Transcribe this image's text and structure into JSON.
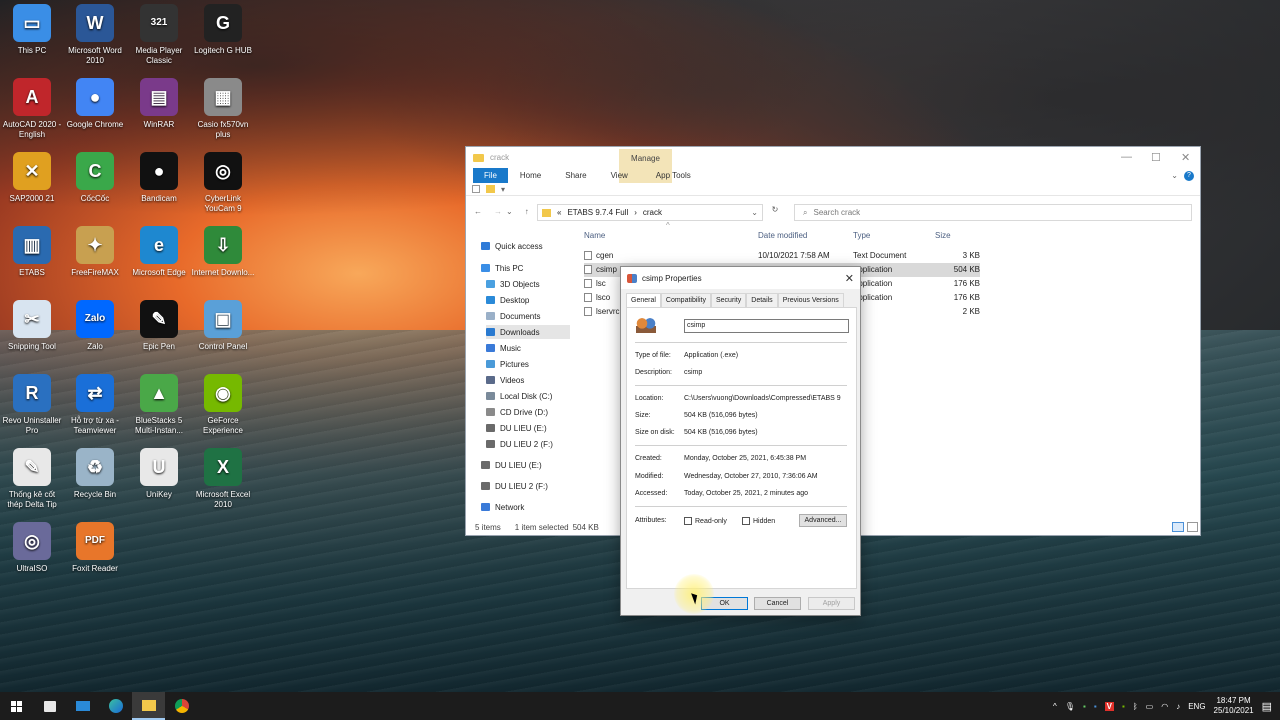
{
  "desktop": {
    "icons": [
      {
        "label": "This PC",
        "icon": "this-pc-icon",
        "color": "#3a8ee6",
        "glyph": "▭"
      },
      {
        "label": "Microsoft Word 2010",
        "icon": "word-icon",
        "color": "#2b5797",
        "glyph": "W"
      },
      {
        "label": "Media Player Classic",
        "icon": "media-player-icon",
        "color": "#333333",
        "glyph": "321"
      },
      {
        "label": "Logitech G HUB",
        "icon": "logitech-icon",
        "color": "#222222",
        "glyph": "G"
      },
      {
        "label": "AutoCAD 2020 - English",
        "icon": "autocad-icon",
        "color": "#c0262b",
        "glyph": "A"
      },
      {
        "label": "Google Chrome",
        "icon": "chrome-icon",
        "color": "#4285f4",
        "glyph": "●"
      },
      {
        "label": "WinRAR",
        "icon": "winrar-icon",
        "color": "#7a3a8a",
        "glyph": "▤"
      },
      {
        "label": "Casio fx570vn plus",
        "icon": "calculator-icon",
        "color": "#8a8a8a",
        "glyph": "▦"
      },
      {
        "label": "SAP2000 21",
        "icon": "sap2000-icon",
        "color": "#e0a020",
        "glyph": "✕"
      },
      {
        "label": "CốcCốc",
        "icon": "coccoc-icon",
        "color": "#3aa84a",
        "glyph": "C"
      },
      {
        "label": "Bandicam",
        "icon": "bandicam-icon",
        "color": "#111111",
        "glyph": "●"
      },
      {
        "label": "CyberLink YouCam 9",
        "icon": "youcam-icon",
        "color": "#111111",
        "glyph": "◎"
      },
      {
        "label": "ETABS",
        "icon": "etabs-icon",
        "color": "#2a6ab0",
        "glyph": "▥"
      },
      {
        "label": "FreeFireMAX",
        "icon": "freefire-icon",
        "color": "#c8a050",
        "glyph": "✦"
      },
      {
        "label": "Microsoft Edge",
        "icon": "edge-icon",
        "color": "#1e88d0",
        "glyph": "e"
      },
      {
        "label": "Internet Downlo...",
        "icon": "idm-icon",
        "color": "#2f8a3a",
        "glyph": "⇩"
      },
      {
        "label": "Snipping Tool",
        "icon": "snipping-tool-icon",
        "color": "#d8e4f0",
        "glyph": "✂"
      },
      {
        "label": "Zalo",
        "icon": "zalo-icon",
        "color": "#0068ff",
        "glyph": "Zalo"
      },
      {
        "label": "Epic Pen",
        "icon": "epic-pen-icon",
        "color": "#111111",
        "glyph": "✎"
      },
      {
        "label": "Control Panel",
        "icon": "control-panel-icon",
        "color": "#5aa0d8",
        "glyph": "▣"
      },
      {
        "label": "Revo Uninstaller Pro",
        "icon": "revo-icon",
        "color": "#2a70c0",
        "glyph": "R"
      },
      {
        "label": "Hỗ trợ từ xa - Teamviewer",
        "icon": "teamviewer-icon",
        "color": "#1a6fd8",
        "glyph": "⇄"
      },
      {
        "label": "BlueStacks 5 Multi-Instan...",
        "icon": "bluestacks-icon",
        "color": "#4aa848",
        "glyph": "▲"
      },
      {
        "label": "GeForce Experience",
        "icon": "geforce-icon",
        "color": "#76b900",
        "glyph": "◉"
      },
      {
        "label": "Thống kê cốt thép Delta Tip",
        "icon": "delta-tip-icon",
        "color": "#e8e8e8",
        "glyph": "✎"
      },
      {
        "label": "Recycle Bin",
        "icon": "recycle-bin-icon",
        "color": "#9ab4c8",
        "glyph": "♻"
      },
      {
        "label": "UniKey",
        "icon": "unikey-icon",
        "color": "#e8e8e8",
        "glyph": "U"
      },
      {
        "label": "Microsoft Excel 2010",
        "icon": "excel-icon",
        "color": "#1f7244",
        "glyph": "X"
      },
      {
        "label": "UltraISO",
        "icon": "ultraiso-icon",
        "color": "#6a6a9a",
        "glyph": "◎"
      },
      {
        "label": "Foxit Reader",
        "icon": "foxit-icon",
        "color": "#e8762a",
        "glyph": "PDF"
      }
    ]
  },
  "explorer": {
    "title": "crack",
    "manage_label": "Manage",
    "tabs": [
      "File",
      "Home",
      "Share",
      "View",
      "App Tools"
    ],
    "breadcrumb": {
      "prefix": "«",
      "parts": [
        "ETABS 9.7.4 Full",
        "›",
        "crack"
      ]
    },
    "search_placeholder": "Search crack",
    "nav": [
      {
        "label": "Quick access",
        "icon": "star-icon",
        "color": "#2f7bd8",
        "indent": 0
      },
      {
        "label": "This PC",
        "icon": "this-pc-icon",
        "color": "#3a8ee6",
        "indent": 0
      },
      {
        "label": "3D Objects",
        "icon": "3d-objects-icon",
        "color": "#4aa0e0",
        "indent": 1
      },
      {
        "label": "Desktop",
        "icon": "desktop-icon",
        "color": "#2a8ad8",
        "indent": 1
      },
      {
        "label": "Documents",
        "icon": "documents-icon",
        "color": "#9ab0c8",
        "indent": 1
      },
      {
        "label": "Downloads",
        "icon": "downloads-icon",
        "color": "#2a7ad0",
        "indent": 1,
        "selected": true
      },
      {
        "label": "Music",
        "icon": "music-icon",
        "color": "#3a7ad8",
        "indent": 1
      },
      {
        "label": "Pictures",
        "icon": "pictures-icon",
        "color": "#4a9ad8",
        "indent": 1
      },
      {
        "label": "Videos",
        "icon": "videos-icon",
        "color": "#5a6a8a",
        "indent": 1
      },
      {
        "label": "Local Disk (C:)",
        "icon": "drive-icon",
        "color": "#7a8a9a",
        "indent": 1
      },
      {
        "label": "CD Drive (D:)",
        "icon": "cd-drive-icon",
        "color": "#8a8a8a",
        "indent": 1
      },
      {
        "label": "DU LIEU (E:)",
        "icon": "drive-icon",
        "color": "#6a6a6a",
        "indent": 1
      },
      {
        "label": "DU LIEU 2 (F:)",
        "icon": "drive-icon",
        "color": "#6a6a6a",
        "indent": 1
      },
      {
        "label": "DU LIEU (E:)",
        "icon": "drive-icon",
        "color": "#6a6a6a",
        "indent": 0
      },
      {
        "label": "DU LIEU 2 (F:)",
        "icon": "drive-icon",
        "color": "#6a6a6a",
        "indent": 0
      },
      {
        "label": "Network",
        "icon": "network-icon",
        "color": "#3a7ad8",
        "indent": 0
      }
    ],
    "columns": [
      "Name",
      "Date modified",
      "Type",
      "Size"
    ],
    "files": [
      {
        "name": "cgen",
        "date": "10/10/2021 7:58 AM",
        "type": "Text Document",
        "size": "3 KB"
      },
      {
        "name": "csimp",
        "date": "",
        "type": "Application",
        "size": "504 KB",
        "selected": true
      },
      {
        "name": "lsc",
        "date": "",
        "type": "Application",
        "size": "176 KB"
      },
      {
        "name": "lsco",
        "date": "",
        "type": "Application",
        "size": "176 KB"
      },
      {
        "name": "lservrc",
        "date": "",
        "type": "e",
        "size": "2 KB"
      }
    ],
    "status": {
      "items": "5 items",
      "selected": "1 item selected",
      "size": "504 KB"
    }
  },
  "dialog": {
    "title": "csimp Properties",
    "tabs": [
      "General",
      "Compatibility",
      "Security",
      "Details",
      "Previous Versions"
    ],
    "name_value": "csimp",
    "rows": {
      "type_label": "Type of file:",
      "type_value": "Application (.exe)",
      "desc_label": "Description:",
      "desc_value": "csimp",
      "loc_label": "Location:",
      "loc_value": "C:\\Users\\vuong\\Downloads\\Compressed\\ETABS 9",
      "size_label": "Size:",
      "size_value": "504 KB (516,096 bytes)",
      "disk_label": "Size on disk:",
      "disk_value": "504 KB (516,096 bytes)",
      "created_label": "Created:",
      "created_value": "Monday, October 25, 2021, 6:45:38 PM",
      "modified_label": "Modified:",
      "modified_value": "Wednesday, October 27, 2010, 7:36:06 AM",
      "accessed_label": "Accessed:",
      "accessed_value": "Today, October 25, 2021, 2 minutes ago",
      "attr_label": "Attributes:",
      "readonly_label": "Read-only",
      "hidden_label": "Hidden"
    },
    "advanced_label": "Advanced...",
    "ok_label": "OK",
    "cancel_label": "Cancel",
    "apply_label": "Apply"
  },
  "taskbar": {
    "apps": [
      "start-icon",
      "store-icon",
      "mail-icon",
      "edge-icon",
      "file-explorer-icon",
      "chrome-icon"
    ],
    "language": "ENG",
    "time": "18:47 PM",
    "date": "25/10/2021"
  }
}
